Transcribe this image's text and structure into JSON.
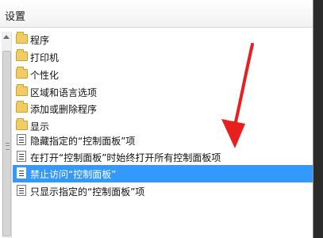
{
  "header": {
    "title": "设置"
  },
  "items": [
    {
      "type": "folder",
      "label": "程序"
    },
    {
      "type": "folder",
      "label": "打印机"
    },
    {
      "type": "folder",
      "label": "个性化"
    },
    {
      "type": "folder",
      "label": "区域和语言选项"
    },
    {
      "type": "folder",
      "label": "添加或删除程序"
    },
    {
      "type": "folder",
      "label": "显示"
    },
    {
      "type": "setting",
      "label": "隐藏指定的“控制面板”项"
    },
    {
      "type": "setting",
      "label": "在打开“控制面板”时始终打开所有控制面板项"
    },
    {
      "type": "setting",
      "label": "禁止访问“控制面板”",
      "selected": true
    },
    {
      "type": "setting",
      "label": "只显示指定的“控制面板”项"
    }
  ],
  "colors": {
    "selection": "#3399ff",
    "annotation_arrow": "#e8201d"
  }
}
